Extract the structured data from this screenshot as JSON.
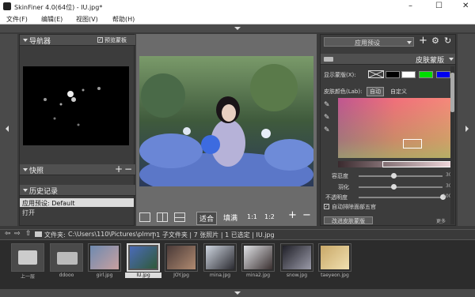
{
  "window": {
    "title": "SkinFiner 4.0(64位) - IU.jpg*",
    "minimize": "–",
    "maximize": "☐",
    "close": "✕"
  },
  "menu": [
    "文件(F)",
    "编辑(E)",
    "视图(V)",
    "帮助(H)"
  ],
  "navigator": {
    "title": "导航器",
    "preview_label": "预览蒙板",
    "preview_checked": true
  },
  "snapshot": {
    "title": "快照",
    "add": "+",
    "remove": "−"
  },
  "history": {
    "title": "历史记录",
    "items": [
      "应用预设: Default",
      "打开"
    ]
  },
  "canvas_toolbar": {
    "fit": "适合",
    "fill": "填满",
    "zoom_1": "1:1",
    "zoom_2": "1:2",
    "zoom_in": "+",
    "zoom_out": "−"
  },
  "preset": {
    "label": "应用预设"
  },
  "skin_mask": {
    "title": "皮肤蒙版",
    "show_mask_label": "显示蒙版(X):",
    "color_label": "皮肤颜色(Lab):",
    "auto_button": "自动",
    "custom_button": "自定义",
    "swatch_colors": [
      "#000000",
      "#ffffff",
      "#00dd00",
      "#0000ee"
    ],
    "tolerance_label": "容忍度",
    "tolerance_value": "30",
    "tolerance_level": 0.42,
    "feather_label": "羽化",
    "feather_value": "30",
    "feather_level": 0.42,
    "opacity_label": "不透明度",
    "opacity_value": "100",
    "opacity_level": 1.0,
    "exclude_label": "自动排除面部五官",
    "exclude_checked": true,
    "improve_button": "改进皮肤蒙版",
    "more": "更多"
  },
  "pathbar": {
    "folder_label": "文件夹:",
    "path": "C:\\Users\\110\\Pictures\\plmm",
    "summary": "| 1 子文件夹 | 7 张照片 | 1 已选定 | IU.jpg"
  },
  "thumbnails": [
    {
      "label": "上一层",
      "kind": "up"
    },
    {
      "label": "ddooo",
      "kind": "folder"
    },
    {
      "label": "girl.jpg",
      "kind": "photo",
      "c1": "#6e8ab0",
      "c2": "#c8a0a0"
    },
    {
      "label": "IU.jpg",
      "kind": "photo",
      "c1": "#4b6bb8",
      "c2": "#2f5a3a",
      "selected": true
    },
    {
      "label": "JOY.jpg",
      "kind": "photo",
      "c1": "#4a3a38",
      "c2": "#b08a70"
    },
    {
      "label": "mina.jpg",
      "kind": "photo",
      "c1": "#cfd6e0",
      "c2": "#2a2a30"
    },
    {
      "label": "mina2.jpg",
      "kind": "photo",
      "c1": "#e0e2e6",
      "c2": "#3a3030"
    },
    {
      "label": "snow.jpg",
      "kind": "photo",
      "c1": "#202028",
      "c2": "#9a9aa8"
    },
    {
      "label": "taeyeon.jpg",
      "kind": "photo",
      "c1": "#c9a868",
      "c2": "#f0e0b0"
    }
  ]
}
